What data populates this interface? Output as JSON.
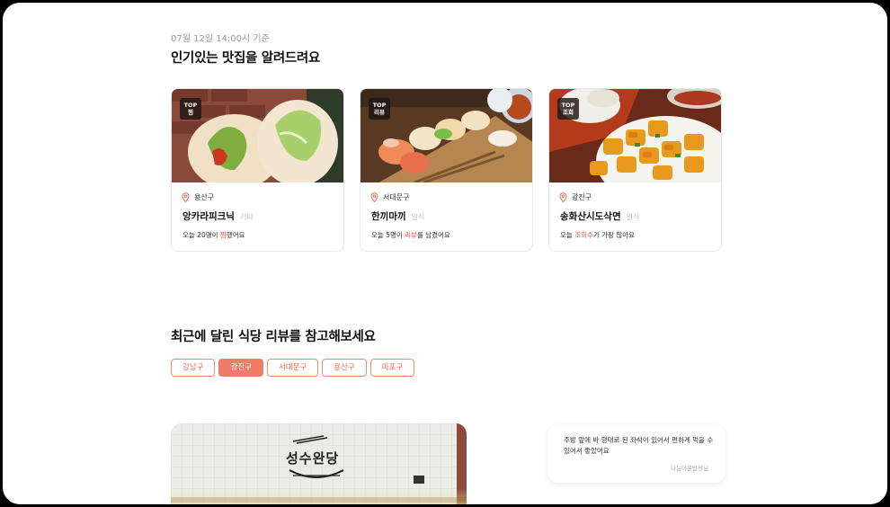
{
  "header": {
    "timestamp": "07월 12일 14:00시 기준",
    "title": "인기있는 맛집을 알려드려요"
  },
  "cards": [
    {
      "badge_top": "TOP",
      "badge_sub": "찜",
      "district": "용산구",
      "name": "앙카라피크닉",
      "category": "기타",
      "note_before": "오늘 20명이 ",
      "note_highlight": "찜",
      "note_after": "했어요",
      "image": "wrap-sandwich-photo"
    },
    {
      "badge_top": "TOP",
      "badge_sub": "리뷰",
      "district": "서대문구",
      "name": "한끼마끼",
      "category": "일식",
      "note_before": "오늘 5명이 ",
      "note_highlight": "리뷰",
      "note_after": "를 남겼어요",
      "image": "sushi-platter-photo"
    },
    {
      "badge_top": "TOP",
      "badge_sub": "조회",
      "district": "광진구",
      "name": "송화산시도삭면",
      "category": "일식",
      "note_before": "오늘 ",
      "note_highlight": "조회수",
      "note_after": "가 가장 많아요",
      "image": "fried-tofu-dish-photo"
    }
  ],
  "reviews_section": {
    "title": "최근에 달린 식당 리뷰를 참고해보세요",
    "chips": [
      {
        "label": "강남구",
        "active": false
      },
      {
        "label": "광진구",
        "active": true
      },
      {
        "label": "서대문구",
        "active": false
      },
      {
        "label": "용산구",
        "active": false
      },
      {
        "label": "마포구",
        "active": false
      }
    ],
    "store_sign": "성수완당",
    "review": {
      "text": "주방 앞에 바 형태로 된 좌석이 있어서 편하게 먹을 수 있어서 좋았어요",
      "author": "나는야혼밥왕님"
    }
  },
  "colors": {
    "accent": "#ef6a52",
    "chip_active_bg": "#ef7c68",
    "badge_bg": "#2a201b"
  }
}
